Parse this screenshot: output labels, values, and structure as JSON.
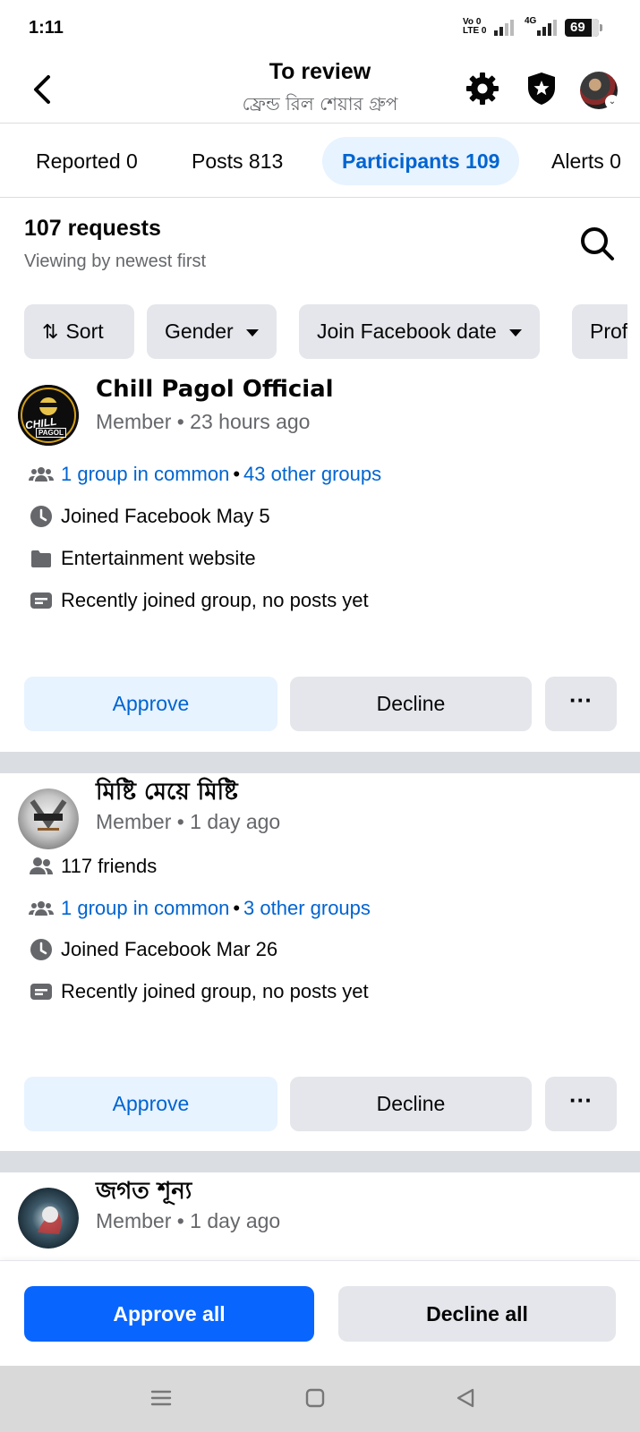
{
  "status_bar": {
    "time": "1:11",
    "network_label_1": "Vo 0",
    "network_label_2": "LTE 0",
    "network_4g": "4G",
    "battery": "69"
  },
  "header": {
    "title": "To review",
    "subtitle": "ফ্রেন্ড রিল শেয়ার গ্রুপ"
  },
  "tabs": [
    {
      "label": "Reported 0"
    },
    {
      "label": "Posts 813"
    },
    {
      "label": "Participants 109",
      "active": true
    },
    {
      "label": "Alerts 0"
    }
  ],
  "requests": {
    "title": "107 requests",
    "subtitle": "Viewing by newest first"
  },
  "filters": {
    "sort": "Sort",
    "gender": "Gender",
    "join_date": "Join Facebook date",
    "profile": "Prof"
  },
  "members": [
    {
      "name": "Chill Pagol Official",
      "meta": "Member • 23 hours ago",
      "groups_common": "1 group in common",
      "groups_other": "43 other groups",
      "joined": "Joined Facebook May 5",
      "category": "Entertainment website",
      "activity": "Recently joined group, no posts yet",
      "avatar_text_1": "CHILL",
      "avatar_text_2": "PAGOL"
    },
    {
      "name": "মিষ্টি মেয়ে মিষ্টি",
      "meta": "Member • 1 day ago",
      "friends": "117 friends",
      "groups_common": "1 group in common",
      "groups_other": "3 other groups",
      "joined": "Joined Facebook Mar 26",
      "activity": "Recently joined group, no posts yet"
    },
    {
      "name": "জগত শূন্য",
      "meta": "Member • 1 day ago"
    }
  ],
  "actions": {
    "approve": "Approve",
    "decline": "Decline",
    "more": "···",
    "approve_all": "Approve all",
    "decline_all": "Decline all"
  },
  "colors": {
    "accent": "#0866ff",
    "link": "#0064d1",
    "approve_bg": "#e7f3ff",
    "neutral_bg": "#e4e6eb"
  },
  "icons": {
    "back": "chevron-left-icon",
    "settings": "gear-icon",
    "shield": "shield-star-icon",
    "search": "search-icon",
    "sort": "sort-arrows-icon",
    "groups": "groups-icon",
    "friends": "friends-icon",
    "clock": "clock-icon",
    "category": "folder-icon",
    "posts": "message-icon"
  }
}
